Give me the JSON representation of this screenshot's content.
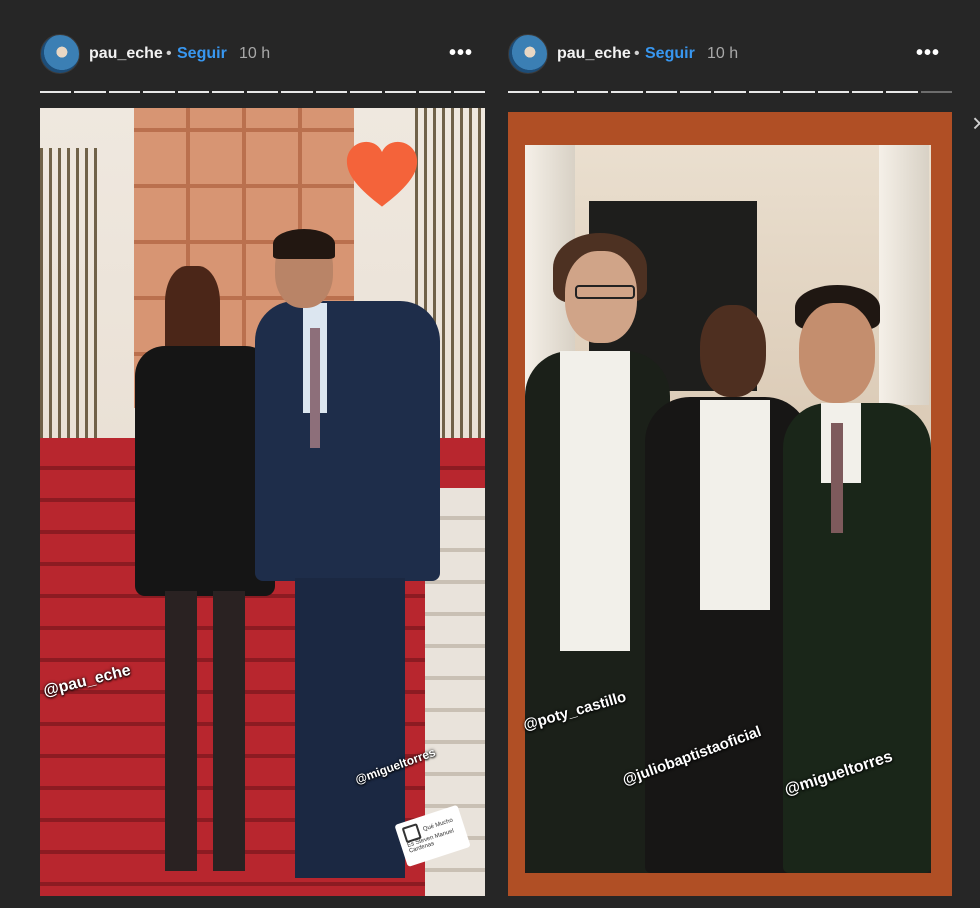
{
  "stories": [
    {
      "username": "pau_eche",
      "separator": "•",
      "follow_label": "Seguir",
      "time": "10 h",
      "more_label": "•••",
      "progress": {
        "segments": 13,
        "viewed": 13
      },
      "mentions": {
        "pau": "@pau_eche",
        "miguel": "@migueltorres"
      },
      "badge_text": "Qué Mucho Es Steven Manuel Cardenas"
    },
    {
      "username": "pau_eche",
      "separator": "•",
      "follow_label": "Seguir",
      "time": "10 h",
      "more_label": "•••",
      "progress": {
        "segments": 13,
        "viewed": 12
      },
      "mentions": {
        "poty": "@poty_castillo",
        "julio": "@juliobaptistaoficial",
        "miguel": "@migueltorres"
      }
    }
  ],
  "close_label": "×",
  "colors": {
    "background": "#262626",
    "follow": "#3897f0",
    "right_frame": "#b04f25",
    "heart": "#f4633a"
  },
  "icons": {
    "heart_sticker": "heart-icon",
    "more": "more-options-icon",
    "close": "close-icon",
    "badge": "ig-logo-icon"
  }
}
